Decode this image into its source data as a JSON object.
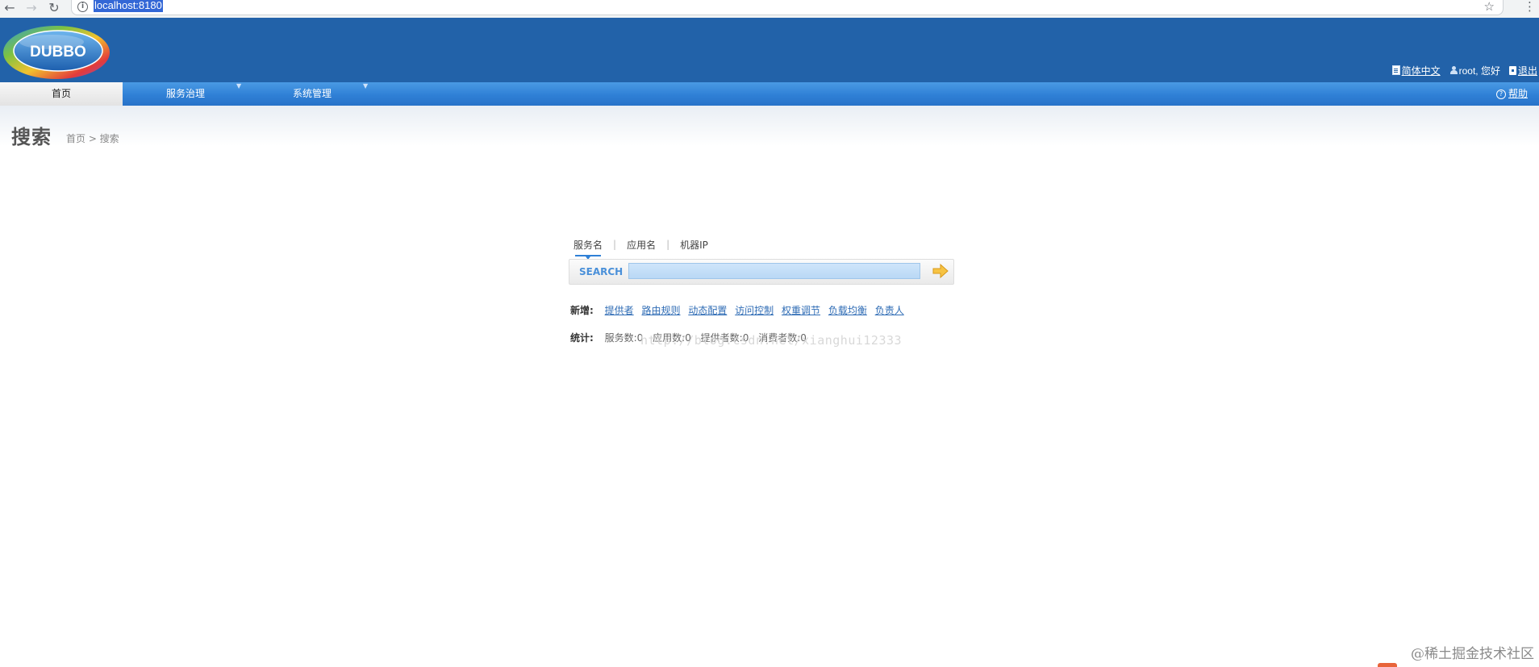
{
  "browser": {
    "url": "localhost:8180",
    "back_icon": "arrow-left-icon",
    "forward_icon": "arrow-right-icon",
    "reload_icon": "reload-icon",
    "bookmark_icon": "star-icon",
    "menu_icon": "kebab-menu-icon"
  },
  "header": {
    "logo_text": "DUBBO",
    "brand_color": "#2262a9",
    "language_link": "简体中文",
    "user_greeting": "root, 您好",
    "logout_link": "退出"
  },
  "nav": {
    "items": [
      {
        "label": "首页",
        "active": true
      },
      {
        "label": "服务治理",
        "has_dropdown": true
      },
      {
        "label": "系统管理",
        "has_dropdown": true
      }
    ],
    "dropdown_caret": "▼",
    "help_label": "帮助"
  },
  "page": {
    "title": "搜索",
    "breadcrumb": "首页 > 搜索"
  },
  "search": {
    "tabs": [
      {
        "label": "服务名",
        "active": true
      },
      {
        "label": "应用名"
      },
      {
        "label": "机器IP"
      }
    ],
    "tab_separator": "|",
    "label": "SEARCH",
    "value": "",
    "go_icon": "arrow-right-icon"
  },
  "add_new": {
    "label": "新增:",
    "links": [
      "提供者",
      "路由规则",
      "动态配置",
      "访问控制",
      "权重调节",
      "负载均衡",
      "负责人"
    ]
  },
  "stats": {
    "label": "统计:",
    "items": [
      "服务数:0",
      "应用数:0",
      "提供者数:0",
      "消费者数:0"
    ]
  },
  "watermark": "http://blog.csdn.net/xianghui12333",
  "corner_watermark": "@稀土掘金技术社区"
}
